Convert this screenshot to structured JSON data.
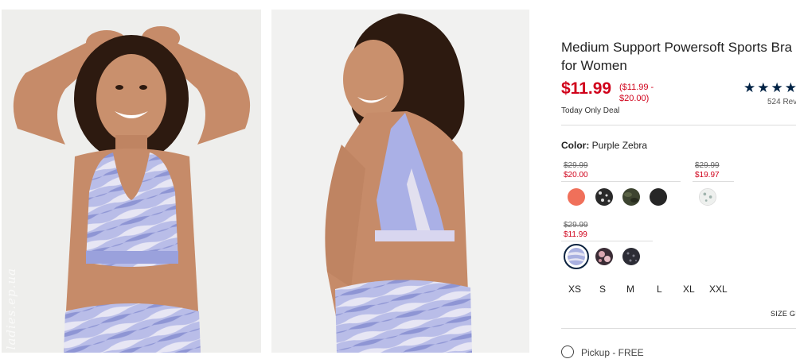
{
  "product": {
    "title": "Medium Support Powersoft Sports Bra for Women",
    "price": "$11.99",
    "price_range": "($11.99 - $20.00)",
    "deal_note": "Today Only Deal",
    "rating": {
      "stars_filled": 4,
      "stars_text": "★★★★",
      "review_count_label": "524 Rev"
    }
  },
  "color": {
    "label": "Color:",
    "selected_name": "Purple Zebra"
  },
  "price_groups": [
    {
      "old_price": "$29.99",
      "new_price": "$20.00",
      "swatches": [
        {
          "name": "coral",
          "color": "#f0705a"
        },
        {
          "name": "black-white-print",
          "color": "#2a2a2a"
        },
        {
          "name": "olive-camo",
          "color": "#3d4430"
        },
        {
          "name": "black",
          "color": "#262626"
        }
      ]
    },
    {
      "old_price": "$29.99",
      "new_price": "$19.97",
      "swatches": [
        {
          "name": "white-print",
          "color": "#e8ecea"
        }
      ]
    },
    {
      "old_price": "$29.99",
      "new_price": "$11.99",
      "swatches": [
        {
          "name": "purple-zebra",
          "color": "#a9b0e0",
          "selected": true
        },
        {
          "name": "pink-floral",
          "color": "#d9a6b0"
        },
        {
          "name": "dark-print",
          "color": "#2c2c35"
        }
      ]
    }
  ],
  "sizes": [
    "XS",
    "S",
    "M",
    "L",
    "XL",
    "XXL"
  ],
  "size_guide_label": "SIZE GU",
  "fulfillment": {
    "pickup_label": "Pickup - FREE"
  },
  "watermark": "ladies.ep.ua",
  "colors": {
    "price_red": "#d0021b",
    "star_navy": "#002244",
    "garment_lavender": "#b5b9e6"
  }
}
